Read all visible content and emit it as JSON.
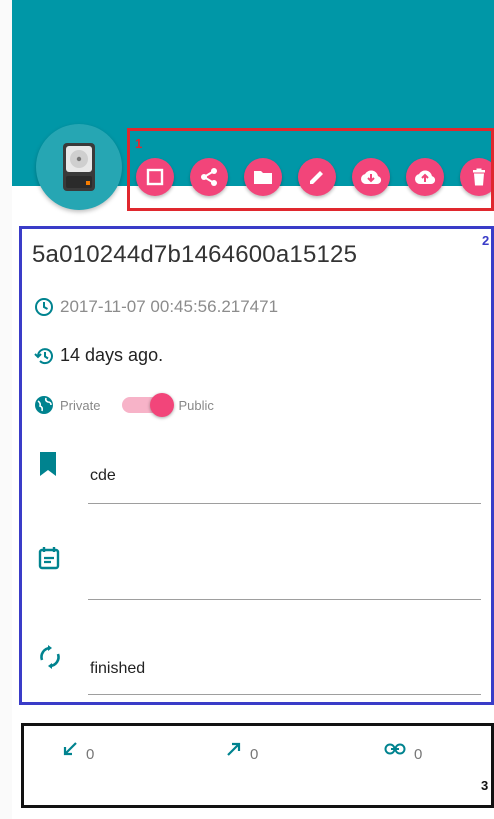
{
  "toolbar": {
    "icons": [
      "stop-square-icon",
      "share-icon",
      "folder-icon",
      "edit-pencil-icon",
      "cloud-download-icon",
      "cloud-upload-icon",
      "delete-icon"
    ]
  },
  "annotations": {
    "box1": "1",
    "box2": "2",
    "box3": "3"
  },
  "details": {
    "id": "5a010244d7b1464600a15125",
    "timestamp": "2017-11-07 00:45:56.217471",
    "relative_time": "14 days ago.",
    "visibility": {
      "left_label": "Private",
      "right_label": "Public",
      "is_public": true
    },
    "fields": {
      "tag": "cde",
      "description": "",
      "status": "finished"
    }
  },
  "stats": {
    "inbound": "0",
    "outbound": "0",
    "links": "0"
  },
  "colors": {
    "header": "#0097a7",
    "accent": "#f2457a",
    "field_icon": "#00838f"
  }
}
